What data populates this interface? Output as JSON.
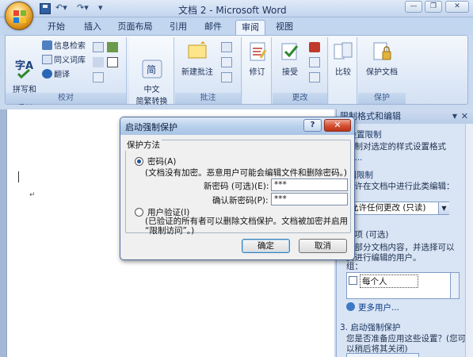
{
  "window": {
    "title": "文档 2 - Microsoft Word"
  },
  "qat": {
    "undo": "↶▾",
    "redo": "↷▾",
    "customize": "▾"
  },
  "tabs": [
    "开始",
    "插入",
    "页面布局",
    "引用",
    "邮件",
    "审阅",
    "视图"
  ],
  "active_tab": "审阅",
  "ribbon": {
    "proofing": {
      "label": "校对",
      "spelling": "拼写和\n语法",
      "research": "信息检索",
      "thesaurus": "同义词库",
      "translate": "翻译"
    },
    "chinese": {
      "convert": "中文\n简繁转换"
    },
    "comments": {
      "label": "批注",
      "new_comment": "新建批注"
    },
    "tracking": {
      "track": "修订"
    },
    "changes": {
      "label": "更改",
      "accept": "接受"
    },
    "compare": {
      "compare": "比较"
    },
    "protect": {
      "label": "保护",
      "protect_doc": "保护文档"
    }
  },
  "document": {
    "para_mark": "↵"
  },
  "task_pane": {
    "title": "限制格式和编辑",
    "sec1_title": "式设置限制",
    "sec1_text": "限制对选定的样式设置格式",
    "sec1_link": "置...",
    "sec2_title": "编辑限制",
    "sec2_text": "允许在文档中进行此类编辑：",
    "sec2_select": "允许任何更改 (只读)",
    "sec2_exceptions": "外项 (可选)",
    "sec2_exc_text": "择部分文档内容，并选择可以\n其进行编辑的用户。",
    "groups_label": "组：",
    "group_everyone": "每个人",
    "more_users": "更多用户...",
    "sec3_title": "3. 启动强制保护",
    "sec3_text": "您是否准备应用这些设置？(您可以稍后将其关闭)"
  },
  "dialog": {
    "title": "启动强制保护",
    "help": "?",
    "close": "✕",
    "group_label": "保护方法",
    "password_option": "密码(A)",
    "password_note": "(文档没有加密。恶意用户可能会编辑文件和删除密码。)",
    "new_password_label": "新密码 (可选)(E):",
    "new_password_value": "***",
    "confirm_password_label": "确认新密码(P):",
    "confirm_password_value": "***",
    "user_auth_option": "用户验证(I)",
    "user_auth_note": "(已验证的所有者可以删除文档保护。文档被加密并启用\n“限制访问”。)",
    "selected_option": "password",
    "ok": "确定",
    "cancel": "取消"
  }
}
